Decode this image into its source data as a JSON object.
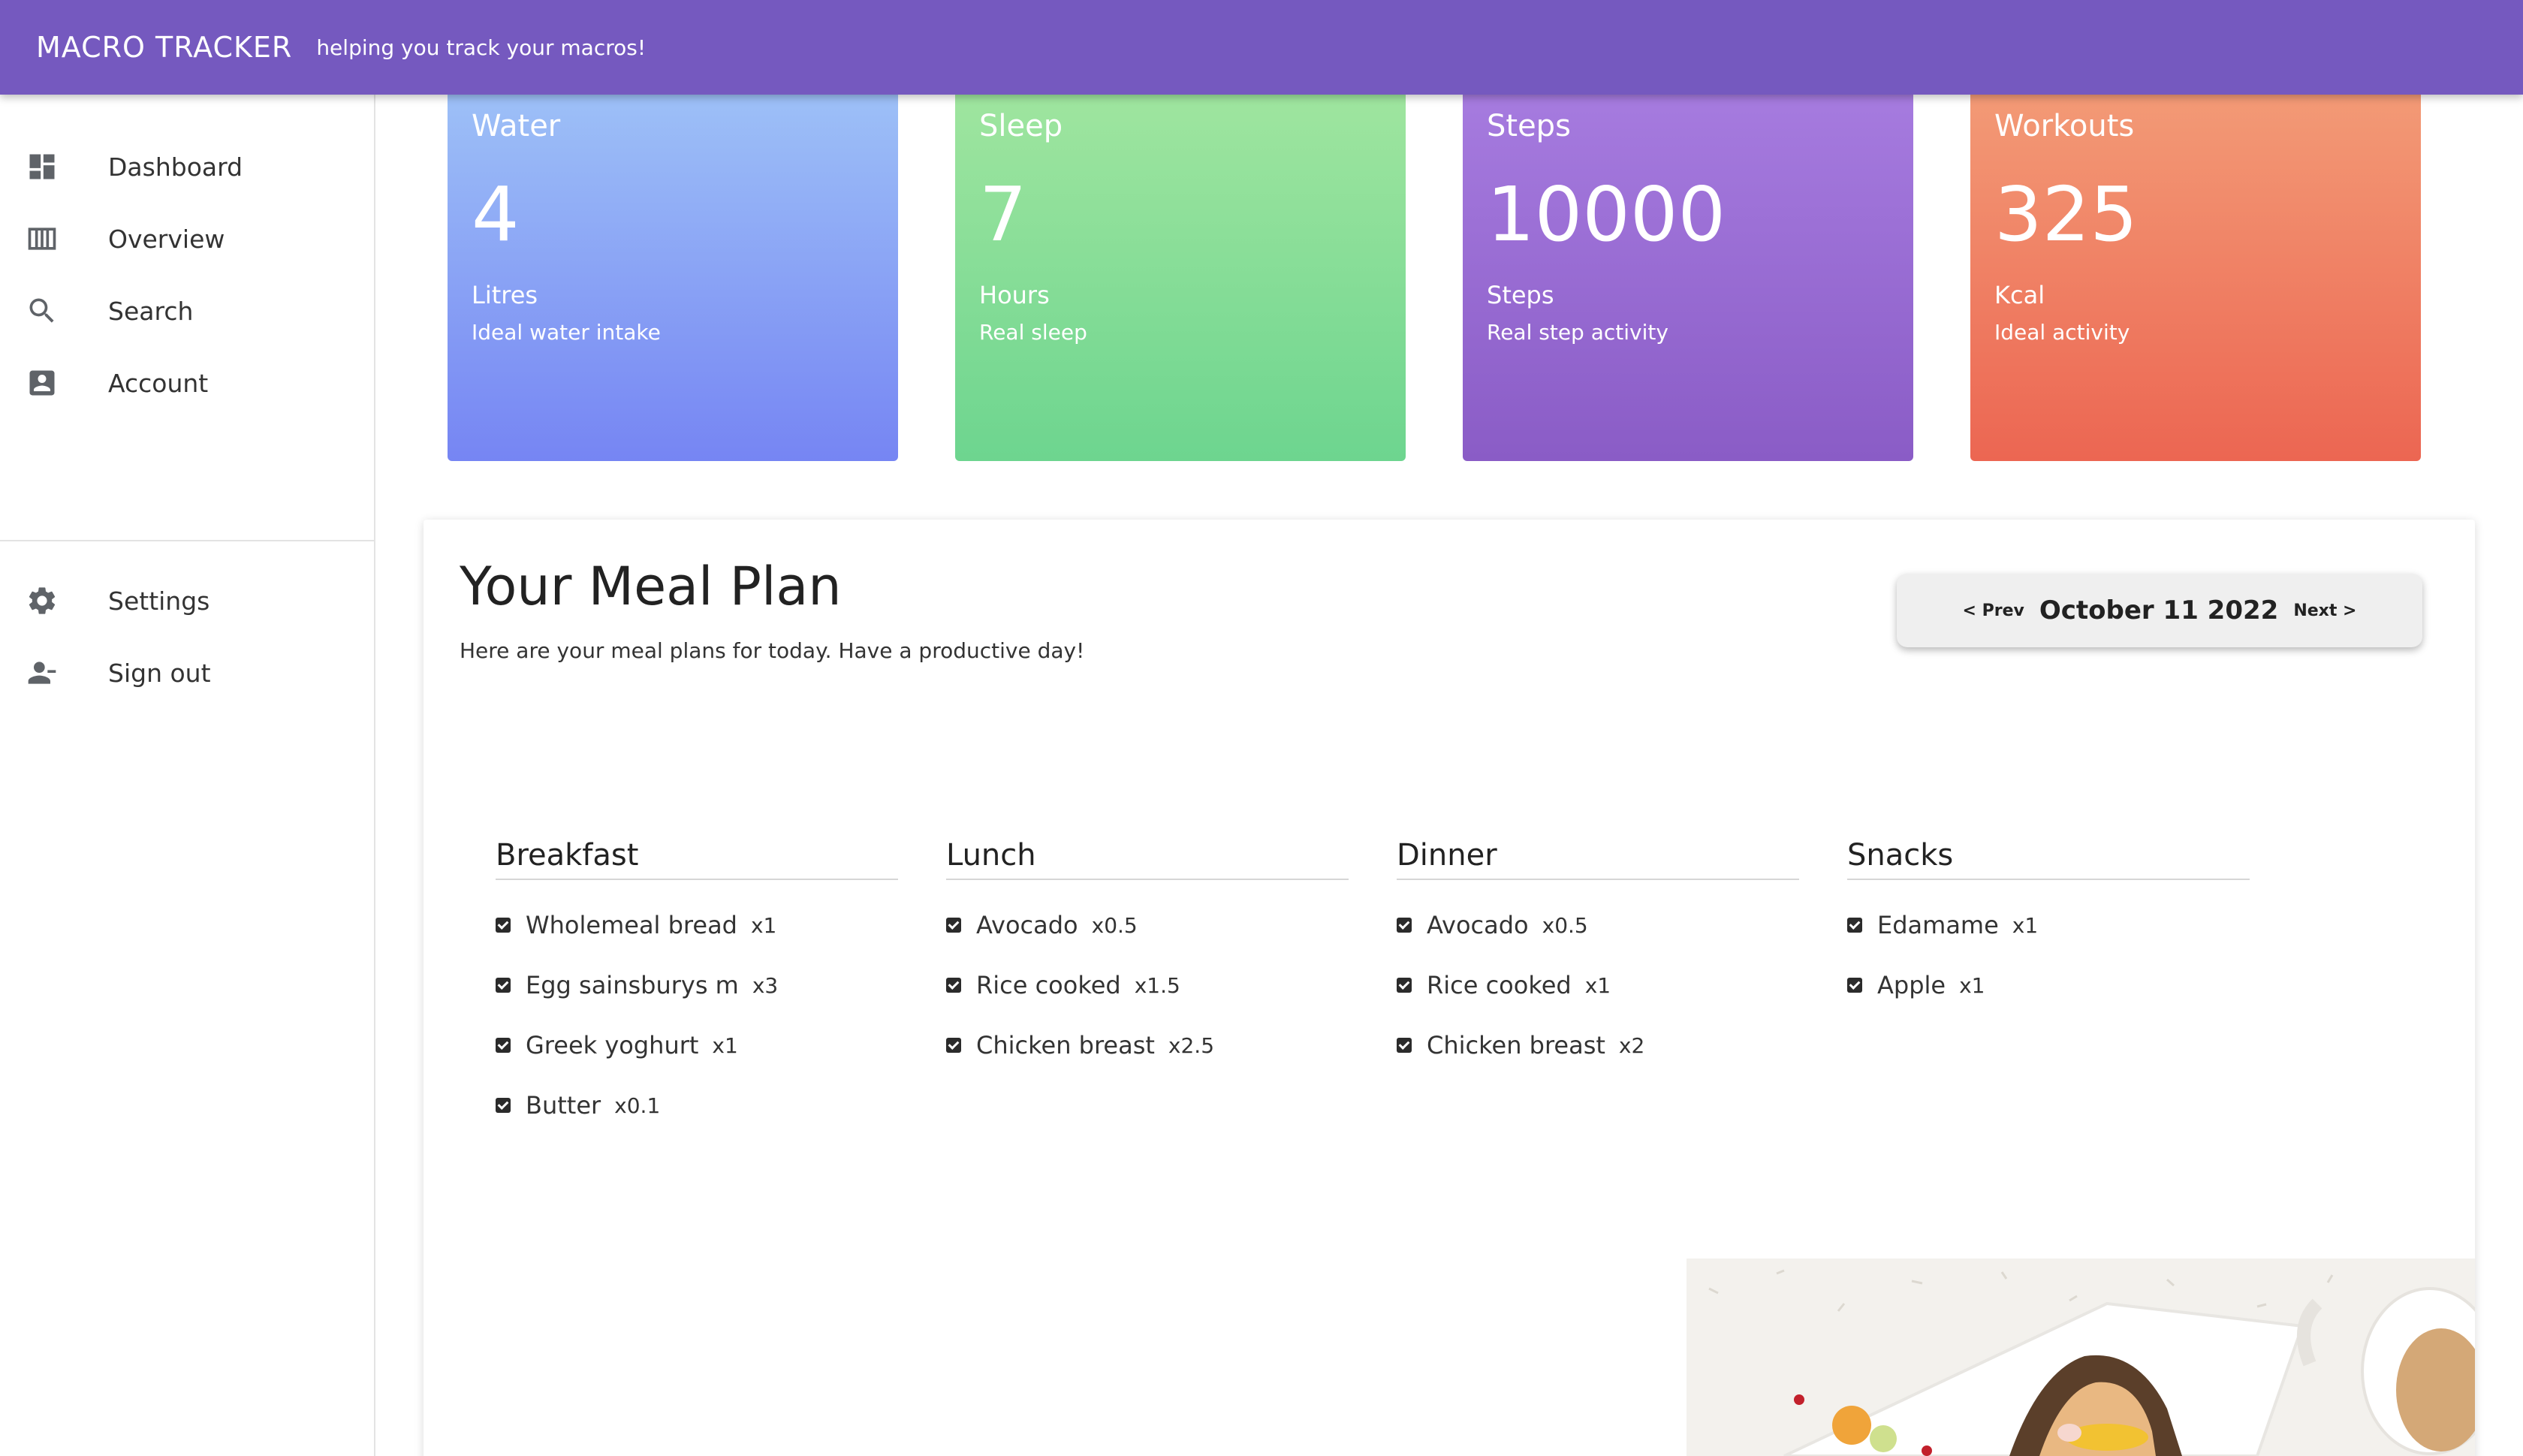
{
  "header": {
    "title": "MACRO TRACKER",
    "subtitle": "helping you track your macros!"
  },
  "sidebar": {
    "items": [
      {
        "label": "Dashboard",
        "icon": "dashboard-icon"
      },
      {
        "label": "Overview",
        "icon": "view-column-icon"
      },
      {
        "label": "Search",
        "icon": "search-icon"
      },
      {
        "label": "Account",
        "icon": "account-box-icon"
      }
    ],
    "bottom_items": [
      {
        "label": "Settings",
        "icon": "gear-icon"
      },
      {
        "label": "Sign out",
        "icon": "person-remove-icon"
      }
    ]
  },
  "stats": [
    {
      "title": "Water",
      "value": "4",
      "unit": "Litres",
      "desc": "Ideal water intake",
      "color": "#7685f3"
    },
    {
      "title": "Sleep",
      "value": "7",
      "unit": "Hours",
      "desc": "Real sleep",
      "color": "#6dd58f"
    },
    {
      "title": "Steps",
      "value": "10000",
      "unit": "Steps",
      "desc": "Real step activity",
      "color": "#8a5cc6"
    },
    {
      "title": "Workouts",
      "value": "325",
      "unit": "Kcal",
      "desc": "Ideal activity",
      "color": "#ec6652"
    }
  ],
  "meal_plan": {
    "title": "Your Meal Plan",
    "subtitle": "Here are your meal plans for today. Have a productive day!",
    "date_nav": {
      "prev": "< Prev",
      "date": "October 11 2022",
      "next": "Next >"
    },
    "meals": [
      {
        "title": "Breakfast",
        "items": [
          {
            "name": "Wholemeal bread",
            "qty": "x1"
          },
          {
            "name": "Egg sainsburys m",
            "qty": "x3"
          },
          {
            "name": "Greek yoghurt",
            "qty": "x1"
          },
          {
            "name": "Butter",
            "qty": "x0.1"
          }
        ]
      },
      {
        "title": "Lunch",
        "items": [
          {
            "name": "Avocado",
            "qty": "x0.5"
          },
          {
            "name": "Rice cooked",
            "qty": "x1.5"
          },
          {
            "name": "Chicken breast",
            "qty": "x2.5"
          }
        ]
      },
      {
        "title": "Dinner",
        "items": [
          {
            "name": "Avocado",
            "qty": "x0.5"
          },
          {
            "name": "Rice cooked",
            "qty": "x1"
          },
          {
            "name": "Chicken breast",
            "qty": "x2"
          }
        ]
      },
      {
        "title": "Snacks",
        "items": [
          {
            "name": "Edamame",
            "qty": "x1"
          },
          {
            "name": "Apple",
            "qty": "x1"
          }
        ]
      }
    ]
  },
  "colors": {
    "brand": "#7559bf"
  }
}
